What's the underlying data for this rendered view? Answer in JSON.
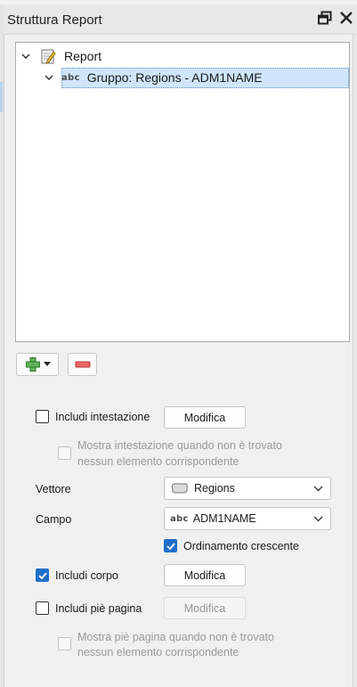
{
  "panel": {
    "title": "Struttura Report"
  },
  "tree": {
    "items": [
      {
        "label": "Report",
        "icon": "report-icon"
      },
      {
        "label": "Gruppo: Regions - ADM1NAME",
        "icon": "abc",
        "selected": true
      }
    ]
  },
  "form": {
    "header_checkbox_label": "Includi intestazione",
    "header_edit_label": "Modifica",
    "header_show_label_line1": "Mostra intestazione quando non è trovato",
    "header_show_label_line2": "nessun elemento corrispondente",
    "layer_label": "Vettore",
    "layer_value": "Regions",
    "field_label": "Campo",
    "field_icon": "abc",
    "field_value": "ADM1NAME",
    "sort_label": "Ordinamento crescente",
    "body_checkbox_label": "Includi corpo",
    "body_edit_label": "Modifica",
    "footer_checkbox_label": "Includi piè pagina",
    "footer_edit_label": "Modifica",
    "footer_show_label_line1": "Mostra piè pagina quando non è trovato",
    "footer_show_label_line2": "nessun elemento corrispondente"
  },
  "state": {
    "include_header": false,
    "show_header_when_empty": false,
    "sort_ascending": true,
    "include_body": true,
    "include_footer": false,
    "show_footer_when_empty": false
  },
  "colors": {
    "accent": "#1f6fc9",
    "selection": "#cfe5fa"
  }
}
